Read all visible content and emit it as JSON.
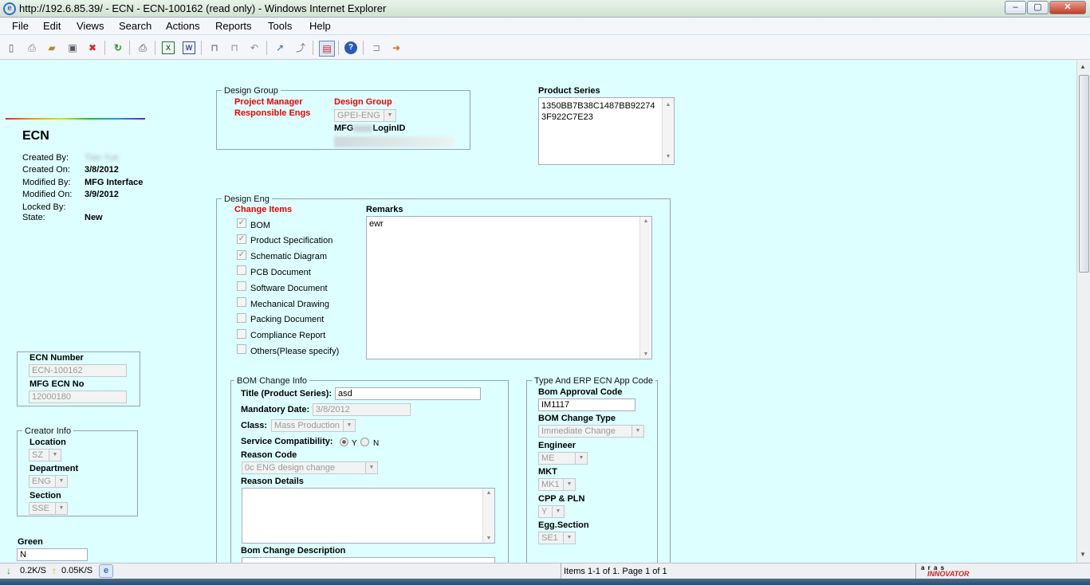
{
  "window": {
    "title": "http://192.6.85.39/ - ECN - ECN-100162 (read only) - Windows Internet Explorer",
    "ie_icon": "e",
    "buttons": {
      "minimize": "–",
      "maximize": "▢",
      "close": "✕"
    }
  },
  "menu": [
    "File",
    "Edit",
    "Views",
    "Search",
    "Actions",
    "Reports",
    "Tools",
    "Help"
  ],
  "toolbar_icons": [
    "new-icon",
    "preview-icon",
    "open-icon",
    "save-icon",
    "delete-icon",
    "refresh-icon",
    "print-icon",
    "excel-icon",
    "word-icon",
    "lock-icon",
    "unlock-icon",
    "undo-icon",
    "promote-icon",
    "export-icon",
    "form-icon",
    "help-icon",
    "unclaim-icon",
    "exit-icon"
  ],
  "header": {
    "title": "ECN",
    "created_by_label": "Created By:",
    "created_by_value": "Tiao Yue",
    "created_on_label": "Created On:",
    "created_on_value": "3/8/2012",
    "modified_by_label": "Modified By:",
    "modified_by_value": "MFG Interface",
    "modified_on_label": "Modified On:",
    "modified_on_value": "3/9/2012",
    "locked_by_label": "Locked By:",
    "state_label": "State:",
    "state_value": "New"
  },
  "ecn_box": {
    "ecn_number_label": "ECN Number",
    "ecn_number_value": "ECN-100162",
    "mfg_ecn_label": "MFG ECN No",
    "mfg_ecn_value": "12000180"
  },
  "creator_info": {
    "legend": "Creator Info",
    "location_label": "Location",
    "location_value": "SZ",
    "department_label": "Department",
    "department_value": "ENG",
    "section_label": "Section",
    "section_value": "SSE"
  },
  "green": {
    "label": "Green",
    "value": "N"
  },
  "design_group": {
    "legend": "Design Group",
    "project_manager": "Project Manager",
    "responsible_engs": "Responsible Engs",
    "design_group_label": "Design Group",
    "design_group_value": "GPEI-ENG",
    "mfg_label_prefix": "MFG",
    "mfg_label_suffix": "LoginID"
  },
  "product_series": {
    "label": "Product Series",
    "value": "1350BB7B38C1487BB922743F922C7E23"
  },
  "design_eng": {
    "legend": "Design Eng",
    "change_items_label": "Change Items",
    "items": [
      {
        "label": "BOM",
        "checked": "✓"
      },
      {
        "label": "Product Specification",
        "checked": "✓"
      },
      {
        "label": "Schematic Diagram",
        "checked": "✓"
      },
      {
        "label": "PCB Document",
        "checked": ""
      },
      {
        "label": "Software Document",
        "checked": ""
      },
      {
        "label": "Mechanical Drawing",
        "checked": ""
      },
      {
        "label": "Packing Document",
        "checked": ""
      },
      {
        "label": "Compliance Report",
        "checked": ""
      },
      {
        "label": "Others(Please specify)",
        "checked": ""
      }
    ],
    "remarks_label": "Remarks",
    "remarks_value": "ewr"
  },
  "bom_change": {
    "legend": "BOM Change Info",
    "title_label": "Title (Product Series):",
    "title_value": "asd",
    "mandatory_date_label": "Mandatory Date:",
    "mandatory_date_value": "3/8/2012",
    "class_label": "Class:",
    "class_value": "Mass Production",
    "service_label": "Service Compatibility:",
    "service_y": "Y",
    "service_n": "N",
    "reason_code_label": "Reason Code",
    "reason_code_value": "0c ENG design change",
    "reason_details_label": "Reason Details",
    "bom_desc_label": "Bom Change Description"
  },
  "erp": {
    "legend": "Type And ERP ECN App Code",
    "bom_approval_label": "Bom Approval Code",
    "bom_approval_value": "IM1117",
    "bom_change_type_label": "BOM Change Type",
    "bom_change_type_value": "Immediate Change",
    "engineer_label": "Engineer",
    "engineer_value": "ME",
    "mkt_label": "MKT",
    "mkt_value": "MK1",
    "cpp_label": "CPP & PLN",
    "cpp_value": "Y",
    "egg_label": "Egg.Section",
    "egg_value": "SE1"
  },
  "status": {
    "down_speed": "0.2K/S",
    "up_speed": "0.05K/S",
    "items_text": "Items 1-1 of 1. Page 1 of 1",
    "brand_top": "a r a s",
    "brand_bottom": "INNOVATOR"
  },
  "colors": {
    "content_bg": "#ddffff",
    "required_red": "#ee0000"
  }
}
